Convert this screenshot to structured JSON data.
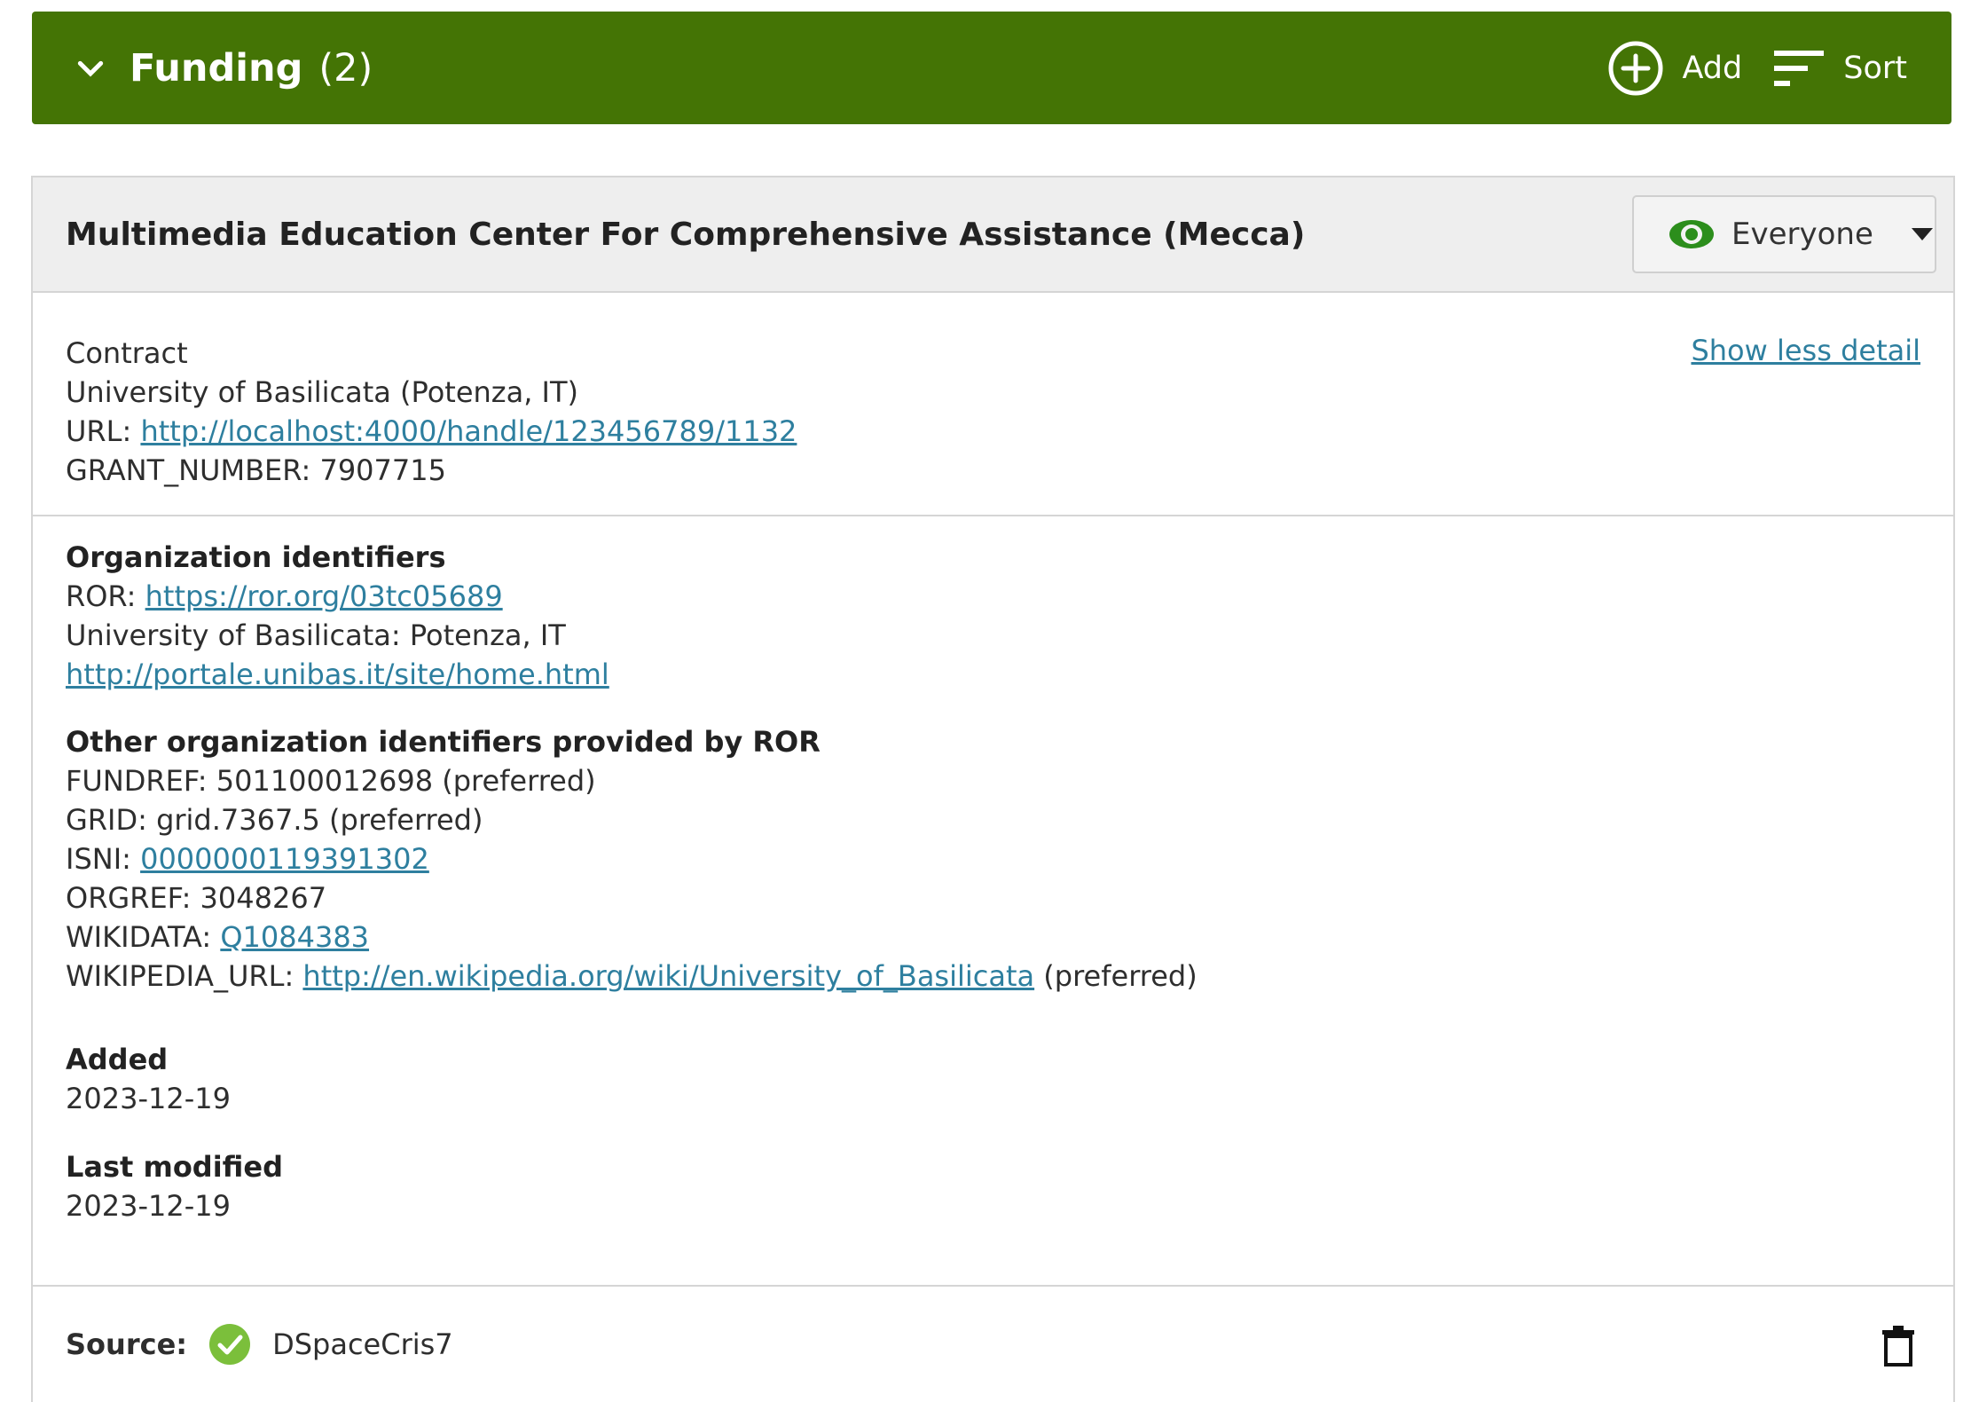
{
  "header": {
    "title": "Funding",
    "count": "(2)",
    "add_label": "Add",
    "sort_label": "Sort"
  },
  "card": {
    "title": "Multimedia Education Center For Comprehensive Assistance (Mecca)",
    "visibility": "Everyone",
    "show_less_label": "Show less detail",
    "type": "Contract",
    "org": "University of Basilicata (Potenza, IT)",
    "url_label": "URL:",
    "url": "http://localhost:4000/handle/123456789/1132",
    "grant": "GRANT_NUMBER: 7907715",
    "org_ids_heading": "Organization identifiers",
    "ror_label": "ROR:",
    "ror_url": "https://ror.org/03tc05689",
    "org_location": "University of Basilicata: Potenza, IT",
    "org_site": "http://portale.unibas.it/site/home.html",
    "other_ids_heading": "Other organization identifiers provided by ROR",
    "fundref": "FUNDREF: 501100012698 (preferred)",
    "grid": "GRID: grid.7367.5 (preferred)",
    "isni_label": "ISNI:",
    "isni_value": "0000000119391302",
    "orgref": "ORGREF: 3048267",
    "wikidata_label": "WIKIDATA:",
    "wikidata_value": "Q1084383",
    "wikipedia_label": "WIKIPEDIA_URL:",
    "wikipedia_url": "http://en.wikipedia.org/wiki/University_of_Basilicata",
    "wikipedia_suffix": "(preferred)",
    "added_heading": "Added",
    "added_date": "2023-12-19",
    "modified_heading": "Last modified",
    "modified_date": "2023-12-19",
    "source_label": "Source:",
    "source_value": "DSpaceCris7"
  },
  "colors": {
    "header_bg": "#447405",
    "link": "#2e7f9f",
    "eye_green": "#2c8e1c",
    "check_green": "#7bbf3b"
  },
  "icons": [
    "chevron-down-icon",
    "add-circle-icon",
    "sort-icon",
    "eye-icon",
    "caret-down-icon",
    "check-circle-icon",
    "trash-icon"
  ]
}
